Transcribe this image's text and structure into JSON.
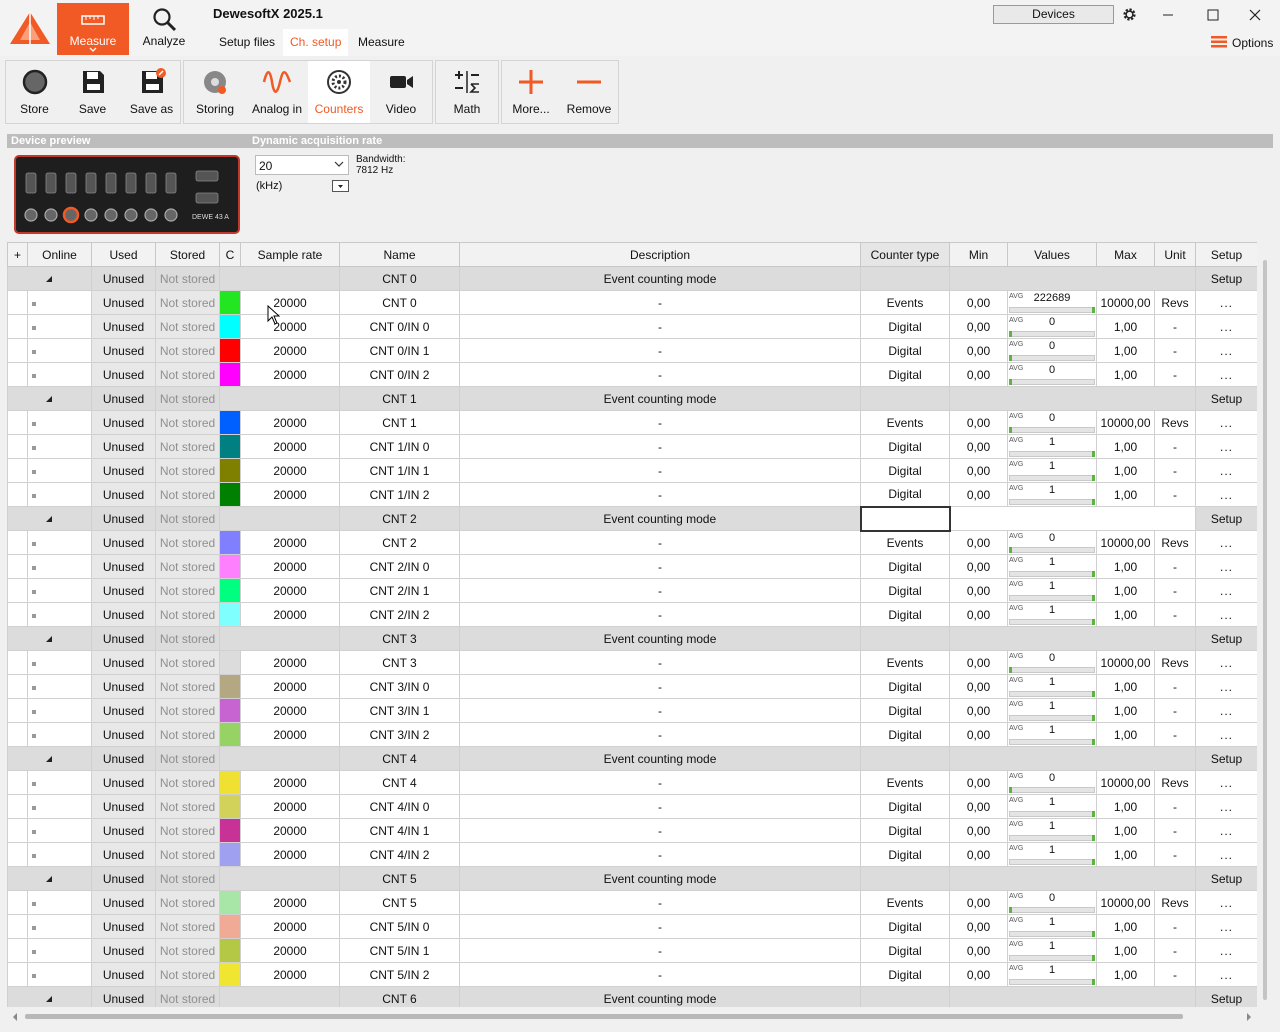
{
  "app": {
    "title": "DewesoftX 2025.1",
    "devices_label": "Devices",
    "options_label": "Options"
  },
  "modes": {
    "measure": "Measure",
    "analyze": "Analyze"
  },
  "subtabs": [
    "Setup files",
    "Ch. setup",
    "Measure"
  ],
  "toolbar": [
    {
      "label": "Store",
      "icon": "record-icon"
    },
    {
      "label": "Save",
      "icon": "save-icon"
    },
    {
      "label": "Save as",
      "icon": "save-as-icon"
    },
    {
      "label": "Storing",
      "icon": "storing-icon"
    },
    {
      "label": "Analog in",
      "icon": "analog-wave-icon"
    },
    {
      "label": "Counters",
      "icon": "counter-wheel-icon",
      "active": true
    },
    {
      "label": "Video",
      "icon": "camera-icon"
    },
    {
      "label": "Math",
      "icon": "math-icon"
    },
    {
      "label": "More...",
      "icon": "plus-icon"
    },
    {
      "label": "Remove",
      "icon": "minus-icon"
    }
  ],
  "preview": {
    "device_preview_label": "Device preview",
    "dynamic_rate_label": "Dynamic acquisition rate",
    "rate_value": "20",
    "rate_unit": "(kHz)",
    "bandwidth_label": "Bandwidth:",
    "bandwidth_value": "7812 Hz",
    "device_model": "DEWE 43 A"
  },
  "columns": [
    "+",
    "Online",
    "Used",
    "Stored",
    "C",
    "Sample rate",
    "Name",
    "Description",
    "Counter type",
    "Min",
    "Values",
    "Max",
    "Unit",
    "Setup"
  ],
  "colors": {
    "accent": "#f15a24",
    "meter": "#5bb540"
  },
  "group_labels": {
    "used": "Unused",
    "stored": "Not stored",
    "description": "Event counting mode",
    "setup": "Setup"
  },
  "groups": [
    {
      "name": "CNT 0",
      "channels": [
        {
          "name": "CNT 0",
          "color": "#22e622",
          "rate": "20000",
          "desc": "-",
          "type": "Events",
          "min": "0,00",
          "value": "222689",
          "fill": 1,
          "max": "10000,00",
          "unit": "Revs"
        },
        {
          "name": "CNT 0/IN 0",
          "color": "#00ffff",
          "rate": "20000",
          "desc": "-",
          "type": "Digital",
          "min": "0,00",
          "value": "0",
          "fill": 0,
          "max": "1,00",
          "unit": "-"
        },
        {
          "name": "CNT 0/IN 1",
          "color": "#ff0000",
          "rate": "20000",
          "desc": "-",
          "type": "Digital",
          "min": "0,00",
          "value": "0",
          "fill": 0,
          "max": "1,00",
          "unit": "-"
        },
        {
          "name": "CNT 0/IN 2",
          "color": "#ff00ff",
          "rate": "20000",
          "desc": "-",
          "type": "Digital",
          "min": "0,00",
          "value": "0",
          "fill": 0,
          "max": "1,00",
          "unit": "-"
        }
      ]
    },
    {
      "name": "CNT 1",
      "channels": [
        {
          "name": "CNT 1",
          "color": "#0060ff",
          "rate": "20000",
          "desc": "-",
          "type": "Events",
          "min": "0,00",
          "value": "0",
          "fill": 0,
          "max": "10000,00",
          "unit": "Revs"
        },
        {
          "name": "CNT 1/IN 0",
          "color": "#008080",
          "rate": "20000",
          "desc": "-",
          "type": "Digital",
          "min": "0,00",
          "value": "1",
          "fill": 1,
          "max": "1,00",
          "unit": "-"
        },
        {
          "name": "CNT 1/IN 1",
          "color": "#808000",
          "rate": "20000",
          "desc": "-",
          "type": "Digital",
          "min": "0,00",
          "value": "1",
          "fill": 1,
          "max": "1,00",
          "unit": "-"
        },
        {
          "name": "CNT 1/IN 2",
          "color": "#008000",
          "rate": "20000",
          "desc": "-",
          "type": "Digital",
          "min": "0,00",
          "value": "1",
          "fill": 1,
          "max": "1,00",
          "unit": "-"
        }
      ]
    },
    {
      "name": "CNT 2",
      "selected": true,
      "channels": [
        {
          "name": "CNT 2",
          "color": "#8080ff",
          "rate": "20000",
          "desc": "-",
          "type": "Events",
          "min": "0,00",
          "value": "0",
          "fill": 0,
          "max": "10000,00",
          "unit": "Revs"
        },
        {
          "name": "CNT 2/IN 0",
          "color": "#ff80ff",
          "rate": "20000",
          "desc": "-",
          "type": "Digital",
          "min": "0,00",
          "value": "1",
          "fill": 1,
          "max": "1,00",
          "unit": "-"
        },
        {
          "name": "CNT 2/IN 1",
          "color": "#00ff80",
          "rate": "20000",
          "desc": "-",
          "type": "Digital",
          "min": "0,00",
          "value": "1",
          "fill": 1,
          "max": "1,00",
          "unit": "-"
        },
        {
          "name": "CNT 2/IN 2",
          "color": "#80ffff",
          "rate": "20000",
          "desc": "-",
          "type": "Digital",
          "min": "0,00",
          "value": "1",
          "fill": 1,
          "max": "1,00",
          "unit": "-"
        }
      ]
    },
    {
      "name": "CNT 3",
      "channels": [
        {
          "name": "CNT 3",
          "color": "#dcdcdc",
          "rate": "20000",
          "desc": "-",
          "type": "Events",
          "min": "0,00",
          "value": "0",
          "fill": 0,
          "max": "10000,00",
          "unit": "Revs"
        },
        {
          "name": "CNT 3/IN 0",
          "color": "#b4a882",
          "rate": "20000",
          "desc": "-",
          "type": "Digital",
          "min": "0,00",
          "value": "1",
          "fill": 1,
          "max": "1,00",
          "unit": "-"
        },
        {
          "name": "CNT 3/IN 1",
          "color": "#c864d2",
          "rate": "20000",
          "desc": "-",
          "type": "Digital",
          "min": "0,00",
          "value": "1",
          "fill": 1,
          "max": "1,00",
          "unit": "-"
        },
        {
          "name": "CNT 3/IN 2",
          "color": "#96d264",
          "rate": "20000",
          "desc": "-",
          "type": "Digital",
          "min": "0,00",
          "value": "1",
          "fill": 1,
          "max": "1,00",
          "unit": "-"
        }
      ]
    },
    {
      "name": "CNT 4",
      "channels": [
        {
          "name": "CNT 4",
          "color": "#f0e032",
          "rate": "20000",
          "desc": "-",
          "type": "Events",
          "min": "0,00",
          "value": "0",
          "fill": 0,
          "max": "10000,00",
          "unit": "Revs"
        },
        {
          "name": "CNT 4/IN 0",
          "color": "#d2d25a",
          "rate": "20000",
          "desc": "-",
          "type": "Digital",
          "min": "0,00",
          "value": "1",
          "fill": 1,
          "max": "1,00",
          "unit": "-"
        },
        {
          "name": "CNT 4/IN 1",
          "color": "#c83296",
          "rate": "20000",
          "desc": "-",
          "type": "Digital",
          "min": "0,00",
          "value": "1",
          "fill": 1,
          "max": "1,00",
          "unit": "-"
        },
        {
          "name": "CNT 4/IN 2",
          "color": "#a0a0f0",
          "rate": "20000",
          "desc": "-",
          "type": "Digital",
          "min": "0,00",
          "value": "1",
          "fill": 1,
          "max": "1,00",
          "unit": "-"
        }
      ]
    },
    {
      "name": "CNT 5",
      "channels": [
        {
          "name": "CNT 5",
          "color": "#a8e6a8",
          "rate": "20000",
          "desc": "-",
          "type": "Events",
          "min": "0,00",
          "value": "0",
          "fill": 0,
          "max": "10000,00",
          "unit": "Revs"
        },
        {
          "name": "CNT 5/IN 0",
          "color": "#f0aa96",
          "rate": "20000",
          "desc": "-",
          "type": "Digital",
          "min": "0,00",
          "value": "1",
          "fill": 1,
          "max": "1,00",
          "unit": "-"
        },
        {
          "name": "CNT 5/IN 1",
          "color": "#b4c846",
          "rate": "20000",
          "desc": "-",
          "type": "Digital",
          "min": "0,00",
          "value": "1",
          "fill": 1,
          "max": "1,00",
          "unit": "-"
        },
        {
          "name": "CNT 5/IN 2",
          "color": "#f0e632",
          "rate": "20000",
          "desc": "-",
          "type": "Digital",
          "min": "0,00",
          "value": "1",
          "fill": 1,
          "max": "1,00",
          "unit": "-"
        }
      ]
    },
    {
      "name": "CNT 6",
      "channels": []
    }
  ]
}
